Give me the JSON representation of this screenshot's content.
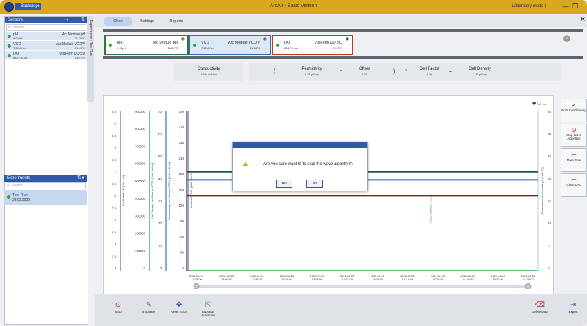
{
  "titlebar": {
    "app_button": "Backsteps",
    "title": "ArcAir - Basic Version",
    "mode": "Laboratory mode |"
  },
  "sensors_panel": {
    "title": "Sensors",
    "search_placeholder": "Search",
    "side_tab": "Experiments : Test Run",
    "items": [
      {
        "name": "pH",
        "value": "6.93pH",
        "module": "Arc Module pH",
        "temp": "21.25°C"
      },
      {
        "name": "VCD",
        "value": "7.29nF/cm",
        "module": "Arc Module VCD/V",
        "temp": "23.49°C"
      },
      {
        "name": "DO",
        "value": "88.17%-sat",
        "module": "VisiFerm DO SU",
        "temp": "23.47°C"
      }
    ]
  },
  "experiments_panel": {
    "title": "Experiments",
    "search_placeholder": "Search",
    "runs": [
      {
        "name": "Test Run",
        "date": "23.02.2022"
      }
    ]
  },
  "tabs": [
    "Chart",
    "Settings",
    "Reports"
  ],
  "cards": [
    {
      "name": "pH",
      "value": "6.93pH",
      "module": "Arc Module pH",
      "temp": "21.26°C",
      "border": "#2a7a3a",
      "bg": "#ffffff"
    },
    {
      "name": "VCD",
      "value": "7.22nF/cm",
      "module": "Arc Module VCD/V",
      "temp": "23.46°C",
      "border": "#2e6fb5",
      "bg": "#dbe8f6"
    },
    {
      "name": "DO",
      "value": "88.17% sat",
      "module": "VisiFerm DO SU",
      "temp": "23.47°C",
      "border": "#b83a2a",
      "bg": "#ffffff"
    }
  ],
  "formula": {
    "conductivity": {
      "label": "Conductivity",
      "value": "6.554 mS/cm"
    },
    "permittivity": {
      "label": "Permittivity",
      "value": "8.31 pF/cm"
    },
    "offset": {
      "label": "Offset",
      "value": "1.02"
    },
    "cell_factor": {
      "label": "Cell Factor",
      "value": "1.00"
    },
    "cell_density": {
      "label": "Cell Density",
      "value": "7.29 pF/cm"
    },
    "ops": {
      "open": "(",
      "minus": "-",
      "close": ")",
      "times": "*",
      "equals": "="
    }
  },
  "chart_data": {
    "type": "line",
    "axes_left": [
      {
        "label": "Arc Module pH [Unit: pH]",
        "ticks": [
          "9.5",
          "9",
          "8.5",
          "8",
          "7.5",
          "7",
          "6.5",
          "6",
          "5.5",
          "5",
          "4.5",
          "4",
          "3.5",
          "3"
        ]
      },
      {
        "label": "Cell Density: Arc Module VCD/V [Unit: pF/cm]",
        "ticks": [
          "900000",
          "800000",
          "700000",
          "600000",
          "500000",
          "400000",
          "300000",
          "200000",
          "100000",
          "0"
        ]
      },
      {
        "label": "Conductivity: Arc Module VCD/V [Unit: mS/cm]",
        "ticks": [
          "70",
          "60",
          "50",
          "40",
          "30",
          "20",
          "10",
          "0"
        ]
      },
      {
        "label": "VisiFerm DO SU [Unit: %-sat]",
        "ticks": [
          "300",
          "270",
          "240",
          "210",
          "180",
          "150",
          "120",
          "90",
          "60",
          "30",
          "0"
        ]
      }
    ],
    "axis_right": {
      "label": "Temperature: Arc Module pH [Unit: °C]",
      "ticks": [
        "35",
        "30",
        "25",
        "20",
        "15",
        "10",
        "5",
        "0"
      ]
    },
    "x_ticks": [
      "2022-02-23\n13:25:00",
      "2022-02-23\n13:30:00",
      "2022-02-23\n13:44:00",
      "2022-02-23\n13:50:00",
      "2022-02-23\n13:56:00",
      "2022-02-23\n14:02:00",
      "2022-02-23\n14:08:00",
      "2022-02-23\n14:14:00",
      "2022-02-23\n14:20:00",
      "2022-02-23\n14:28:00",
      "2022-02-23\n14:32:00",
      "2022-02-23\n14:38:00"
    ],
    "series": [
      {
        "color": "#1a5a3a",
        "y_frac": 0.38
      },
      {
        "color": "#2f62b0",
        "y_frac": 0.43
      },
      {
        "color": "#8a1a1a",
        "y_frac": 0.53
      }
    ],
    "annotation": "Failure: start/stop wave"
  },
  "side_buttons": [
    {
      "label": "Print Conditioning",
      "icon": "✓"
    },
    {
      "label": "Stop Wave Algorithm",
      "icon": "⊙"
    },
    {
      "label": "Mark Zero",
      "icon": "⊢"
    },
    {
      "label": "Clear Zero",
      "icon": "⊢"
    }
  ],
  "bottom_buttons": [
    {
      "label": "Stop",
      "icon": "⊙"
    },
    {
      "label": "Inoculate",
      "icon": "✎"
    },
    {
      "label": "Reset Zoom",
      "icon": "✥"
    },
    {
      "label": "ENABLE Autoscale",
      "icon": "⇱"
    },
    {
      "label": "Delete Data",
      "icon": "⌫"
    },
    {
      "label": "Export",
      "icon": "⇥"
    }
  ],
  "dialog": {
    "message": "Are you sure want to to stop the wave algorithm?",
    "yes": "Yes",
    "no": "No"
  },
  "colors": {
    "accent": "#2e5aa8",
    "titlebar": "#d8a81e"
  }
}
